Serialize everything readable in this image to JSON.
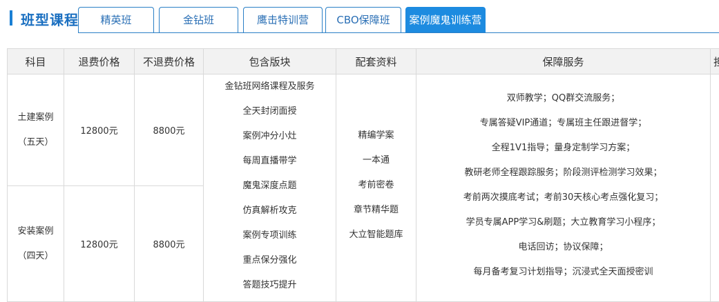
{
  "header": {
    "title": "班型课程",
    "tabs": [
      {
        "label": "精英班",
        "active": false
      },
      {
        "label": "金钻班",
        "active": false
      },
      {
        "label": "鹰击特训营",
        "active": false
      },
      {
        "label": "CBO保障班",
        "active": false
      },
      {
        "label": "案例魔鬼训练营",
        "active": true
      }
    ]
  },
  "table": {
    "columns": [
      "科目",
      "退费价格",
      "不退费价格",
      "包含版块",
      "配套资料",
      "保障服务",
      "担"
    ],
    "rows": [
      {
        "subject": "土建案例",
        "duration": "（五天）",
        "refund_price": "12800元",
        "no_refund_price": "8800元"
      },
      {
        "subject": "安装案例",
        "duration": "（四天）",
        "refund_price": "12800元",
        "no_refund_price": "8800元"
      }
    ],
    "modules": [
      "金钻班网络课程及服务",
      "全天封闭面授",
      "案例冲分小灶",
      "每周直播带学",
      "魔鬼深度点题",
      "仿真解析攻克",
      "案例专项训练",
      "重点保分强化",
      "答题技巧提升"
    ],
    "materials": [
      "精编学案",
      "一本通",
      "考前密卷",
      "章节精华题",
      "大立智能题库"
    ],
    "services": [
      "双师教学；QQ群交流服务；",
      "专属答疑VIP通道；专属班主任跟进督学；",
      "全程1V1指导；量身定制学习方案；",
      "教研老师全程跟踪服务；阶段测评检测学习效果；",
      "考前两次摸底考试；考前30天核心考点强化复习；",
      "学员专属APP学习&刷题；大立教育学习小程序；",
      "电话回访；协议保障；",
      "每月备考复习计划指导；沉浸式全天面授密训"
    ]
  },
  "colors": {
    "accent": "#1d8be0",
    "title": "#1a6fc0",
    "header_bg": "#f2f2f2",
    "border": "#d9d9d9"
  }
}
